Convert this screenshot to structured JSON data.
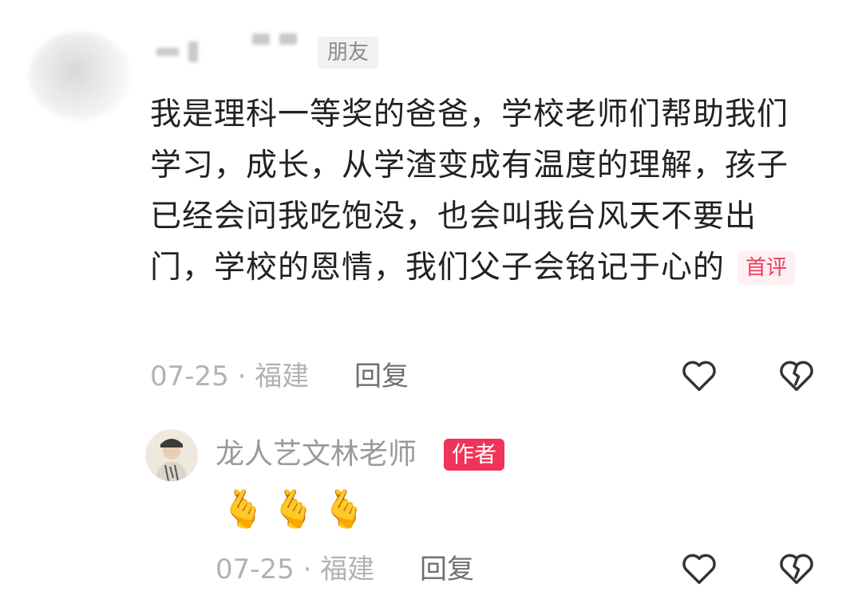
{
  "comment": {
    "friend_badge": "朋友",
    "text": "我是理科一等奖的爸爸，学校老师们帮助我们学习，成长，从学渣变成有温度的理解，孩子已经会问我吃饱没，也会叫我台风天不要出门，学校的恩情，我们父子会铭记于心的",
    "first_badge": "首评",
    "date": "07-25",
    "location": "福建",
    "reply_label": "回复"
  },
  "author_reply": {
    "name": "龙人艺文林老师",
    "author_badge": "作者",
    "text": "🫰🫰🫰",
    "date": "07-25",
    "location": "福建",
    "reply_label": "回复"
  },
  "icons": {
    "like": "heart-outline-icon",
    "dislike": "broken-heart-icon"
  },
  "colors": {
    "author_badge": "#f0335a",
    "first_badge_text": "#e8405f",
    "meta_text": "#b2b2b2"
  }
}
